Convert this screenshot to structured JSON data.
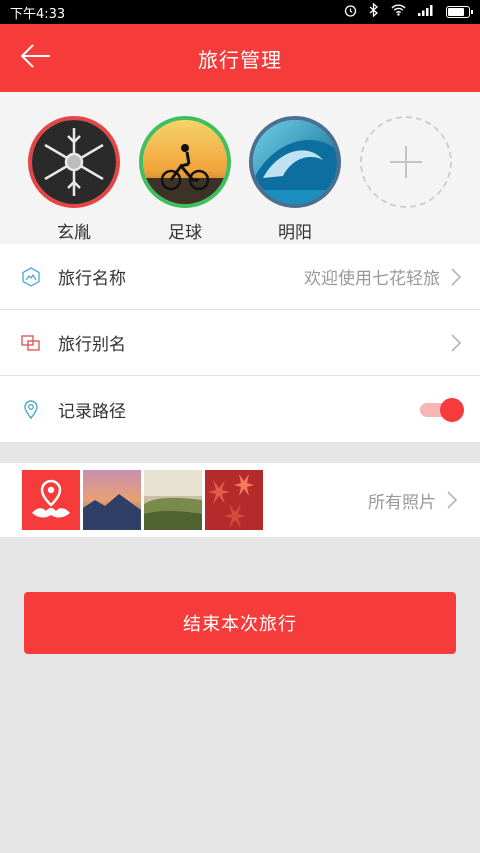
{
  "status_bar": {
    "time": "下午4:33",
    "icons": [
      "alarm-icon",
      "bluetooth-icon",
      "wifi-icon",
      "signal-icon",
      "battery-icon"
    ],
    "battery_level": 0.85
  },
  "header": {
    "title": "旅行管理",
    "back_icon": "arrow-left-icon"
  },
  "members": [
    {
      "name": "玄胤",
      "border_color": "#e64545"
    },
    {
      "name": "足球",
      "border_color": "#3fbf5f"
    },
    {
      "name": "明阳",
      "border_color": "#4a6f8f"
    }
  ],
  "add_member_icon": "plus-icon",
  "menu": {
    "trip_name": {
      "label": "旅行名称",
      "value": "欢迎使用七花轻旅",
      "icon": "mountain-icon"
    },
    "trip_alias": {
      "label": "旅行别名",
      "icon": "overlap-squares-icon"
    },
    "record_route": {
      "label": "记录路径",
      "icon": "location-pin-icon",
      "enabled": true
    }
  },
  "photos": {
    "label": "所有照片",
    "logo_icon": "map-pin-logo-icon"
  },
  "end_button": {
    "label": "结束本次旅行"
  },
  "colors": {
    "brand": "#f63b3b",
    "background": "#e6e6e6"
  }
}
